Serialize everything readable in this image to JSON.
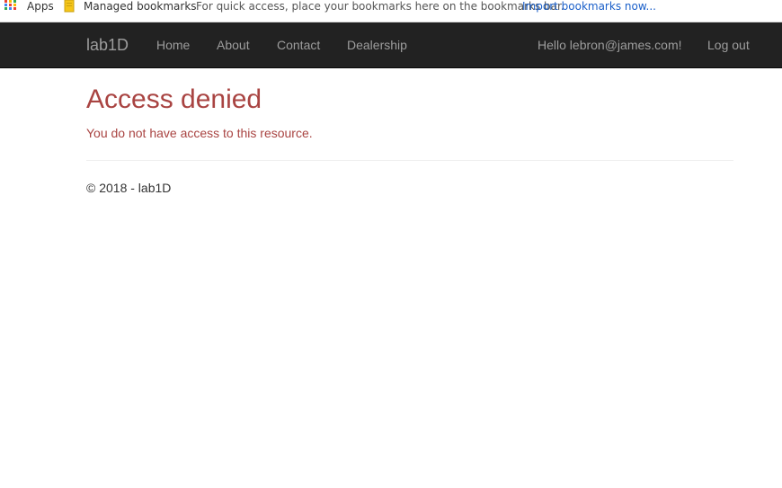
{
  "bookmarks_bar": {
    "apps_label": "Apps",
    "managed_label": "Managed bookmarks",
    "hint": "For quick access, place your bookmarks here on the bookmarks bar.",
    "import_link": "Import bookmarks now..."
  },
  "navbar": {
    "brand": "lab1D",
    "links": [
      "Home",
      "About",
      "Contact",
      "Dealership"
    ],
    "greeting": "Hello lebron@james.com!",
    "logout": "Log out",
    "background": "#222222",
    "link_color": "#9d9d9d"
  },
  "main": {
    "title": "Access denied",
    "message": "You do not have access to this resource.",
    "error_color": "#a94442"
  },
  "footer": {
    "text": "© 2018 - lab1D"
  }
}
